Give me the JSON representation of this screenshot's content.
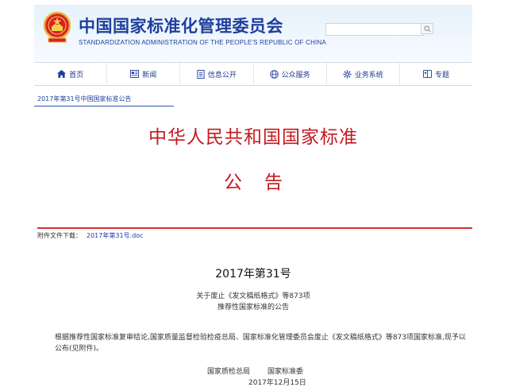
{
  "header": {
    "title": "中国国家标准化管理委员会",
    "subtitle": "STANDARDIZATION ADMINISTRATION OF THE PEOPLE'S REPUBLIC OF CHINA",
    "search": {
      "placeholder": "",
      "icon": "search-icon"
    },
    "emblem_icon": "national-emblem-icon"
  },
  "nav": {
    "items": [
      {
        "label": "首页",
        "icon": "home-icon"
      },
      {
        "label": "新闻",
        "icon": "news-icon"
      },
      {
        "label": "信息公开",
        "icon": "document-icon"
      },
      {
        "label": "公众服务",
        "icon": "globe-icon"
      },
      {
        "label": "业务系统",
        "icon": "gear-icon"
      },
      {
        "label": "专题",
        "icon": "book-icon"
      }
    ]
  },
  "breadcrumb": "2017年第31号中国国家标准公告",
  "notice": {
    "title": "中华人民共和国国家标准",
    "subtitle": "公告",
    "attachment_label": "附件文件下载：",
    "attachment_link": "2017年第31号.doc",
    "doc_number": "2017年第31号",
    "subject_line1": "关于废止《发文稿纸格式》等873项",
    "subject_line2": "推荐性国家标准的公告",
    "body": "根据推荐性国家标准复审结论,国家质量监督检验检疫总局、国家标准化管理委员会废止《发文稿纸格式》等873项国家标准,现予以公布(见附件)。",
    "signer1": "国家质检总局",
    "signer2": "国家标准委",
    "date": "2017年12月15日"
  },
  "colors": {
    "brand_blue": "#1f3f9e",
    "notice_red": "#c4191f"
  }
}
